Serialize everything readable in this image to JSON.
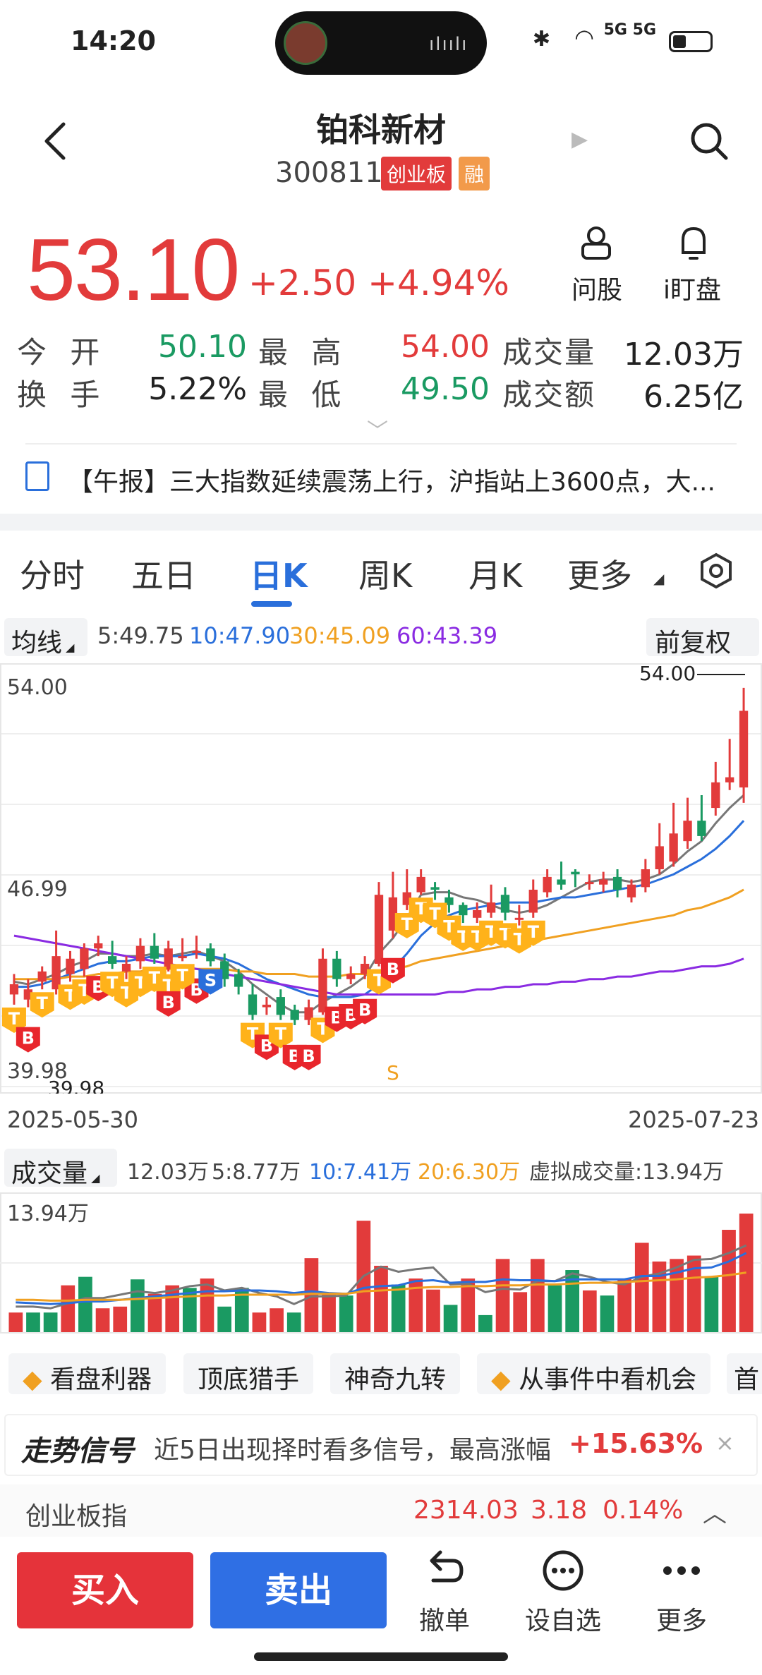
{
  "status_bar": {
    "time": "14:20",
    "signal": "5G 5G"
  },
  "header": {
    "stock_name": "铂科新材",
    "stock_code": "300811",
    "board_tag": "创业板",
    "margin_tag": "融"
  },
  "price": {
    "last": "53.10",
    "change": "+2.50",
    "change_pct": "+4.94%"
  },
  "actions": {
    "ask_label": "问股",
    "watch_label": "i盯盘"
  },
  "quote": {
    "open_label": "今 开",
    "open": "50.10",
    "high_label": "最 高",
    "high": "54.00",
    "volume_label": "成交量",
    "volume": "12.03万",
    "turnover_label": "换 手",
    "turnover": "5.22%",
    "low_label": "最 低",
    "low": "49.50",
    "amount_label": "成交额",
    "amount": "6.25亿"
  },
  "news": {
    "text": "【午报】三大指数延续震荡上行，沪指站上3600点，大..."
  },
  "tabs": [
    "分时",
    "五日",
    "日K",
    "周K",
    "月K",
    "更多"
  ],
  "active_tab": "日K",
  "ma": {
    "dropdown": "均线",
    "ma5": "5:49.75",
    "ma10": "10:47.90",
    "ma30": "30:45.09",
    "ma60": "60:43.39",
    "adjust": "前复权"
  },
  "chart_labels": {
    "y_top": "54.00",
    "y_mid": "46.99",
    "y_bottom": "39.98",
    "high_marker": "54.00",
    "low_marker": "39.98",
    "date_start": "2025-05-30",
    "date_end": "2025-07-23",
    "signal_s": "S"
  },
  "volume": {
    "dropdown": "成交量",
    "current": "12.03万",
    "ma5": "5:8.77万",
    "ma10": "10:7.41万",
    "ma20": "20:6.30万",
    "virtual": "虚拟成交量:13.94万",
    "y_top": "13.94万"
  },
  "chart_data": {
    "type": "candlestick",
    "dates": [
      "2025-05-30",
      "2025-07-23"
    ],
    "ylim": [
      39.98,
      54.0
    ],
    "open": [
      42.0,
      41.8,
      42.5,
      42.2,
      42.8,
      43.0,
      43.8,
      43.5,
      42.9,
      43.3,
      43.9,
      43.0,
      43.5,
      43.7,
      43.8,
      43.3,
      42.8,
      42.0,
      41.5,
      41.9,
      41.4,
      41.0,
      41.3,
      43.4,
      42.6,
      42.8,
      43.2,
      44.5,
      45.5,
      46.0,
      46.2,
      45.8,
      45.5,
      45.0,
      45.2,
      45.9,
      45.0,
      45.2,
      46.0,
      46.5,
      46.8,
      46.4,
      46.3,
      46.6,
      45.8,
      46.2,
      46.9,
      47.2,
      48.0,
      48.8,
      49.3,
      50.3,
      50.1
    ],
    "close": [
      42.4,
      42.2,
      42.9,
      43.5,
      43.4,
      43.8,
      44.0,
      43.2,
      43.2,
      43.9,
      43.4,
      43.8,
      43.5,
      43.7,
      43.3,
      42.6,
      42.3,
      41.2,
      41.6,
      41.2,
      41.0,
      41.5,
      43.4,
      42.6,
      42.8,
      43.2,
      45.9,
      45.8,
      46.0,
      46.6,
      46.1,
      45.5,
      45.1,
      45.3,
      45.6,
      45.2,
      45.0,
      46.1,
      46.6,
      46.3,
      46.7,
      46.4,
      46.5,
      46.1,
      46.3,
      46.9,
      47.8,
      48.3,
      48.8,
      48.2,
      50.3,
      50.5,
      53.1
    ],
    "high": [
      42.8,
      42.6,
      43.1,
      44.5,
      43.7,
      44.0,
      44.3,
      44.1,
      43.5,
      44.2,
      44.4,
      44.1,
      44.2,
      44.3,
      44.0,
      43.6,
      43.0,
      42.4,
      41.9,
      42.2,
      41.6,
      41.8,
      43.8,
      43.7,
      43.1,
      43.5,
      46.4,
      46.8,
      46.9,
      46.9,
      46.4,
      46.1,
      45.6,
      45.6,
      46.3,
      46.2,
      45.5,
      46.5,
      46.9,
      47.2,
      46.9,
      46.7,
      46.8,
      46.9,
      46.5,
      47.3,
      48.7,
      49.5,
      49.7,
      49.8,
      51.1,
      52.0,
      54.0
    ],
    "low": [
      41.6,
      41.5,
      42.2,
      42.0,
      42.5,
      42.7,
      43.5,
      43.0,
      42.6,
      43.0,
      43.2,
      42.9,
      43.3,
      43.4,
      43.1,
      42.3,
      42.0,
      41.0,
      41.2,
      41.0,
      40.8,
      40.8,
      41.2,
      42.3,
      42.4,
      42.6,
      43.1,
      44.2,
      45.3,
      45.9,
      45.7,
      45.2,
      44.8,
      44.8,
      45.0,
      44.9,
      44.7,
      45.0,
      45.8,
      46.1,
      46.2,
      46.1,
      46.0,
      45.8,
      45.6,
      46.0,
      46.7,
      47.0,
      47.7,
      48.0,
      49.0,
      50.0,
      49.5
    ],
    "ma_series": [
      {
        "name": "5",
        "color": "#777777",
        "values": [
          42.5,
          42.4,
          42.6,
          42.8,
          43.1,
          43.3,
          43.6,
          43.6,
          43.5,
          43.5,
          43.6,
          43.5,
          43.6,
          43.7,
          43.5,
          43.3,
          42.9,
          42.4,
          42.0,
          41.6,
          41.3,
          41.3,
          41.7,
          42.0,
          42.3,
          42.7,
          43.6,
          44.2,
          45.0,
          45.9,
          46.0,
          46.0,
          45.8,
          45.7,
          45.5,
          45.3,
          45.2,
          45.3,
          45.5,
          45.8,
          46.1,
          46.4,
          46.5,
          46.5,
          46.4,
          46.5,
          46.7,
          47.1,
          47.6,
          48.0,
          48.7,
          49.3,
          49.8
        ]
      },
      {
        "name": "10",
        "color": "#2a6fdb",
        "values": [
          42.3,
          42.3,
          42.4,
          42.6,
          42.8,
          43.0,
          43.2,
          43.3,
          43.3,
          43.4,
          43.5,
          43.5,
          43.5,
          43.6,
          43.5,
          43.4,
          43.2,
          42.9,
          42.6,
          42.4,
          42.2,
          42.0,
          41.9,
          41.9,
          41.9,
          42.0,
          42.4,
          43.0,
          43.6,
          44.3,
          44.8,
          45.1,
          45.3,
          45.4,
          45.5,
          45.6,
          45.6,
          45.6,
          45.7,
          45.8,
          45.8,
          45.9,
          46.0,
          46.1,
          46.2,
          46.3,
          46.5,
          46.7,
          47.0,
          47.3,
          47.7,
          48.2,
          48.8
        ]
      },
      {
        "name": "30",
        "color": "#f0a021",
        "values": [
          42.6,
          42.6,
          42.6,
          42.6,
          42.7,
          42.7,
          42.8,
          42.8,
          42.9,
          42.9,
          43.0,
          43.0,
          43.0,
          43.0,
          43.0,
          43.0,
          42.9,
          42.9,
          42.8,
          42.8,
          42.8,
          42.7,
          42.7,
          42.7,
          42.8,
          42.8,
          42.9,
          43.0,
          43.1,
          43.3,
          43.4,
          43.5,
          43.6,
          43.7,
          43.8,
          43.9,
          44.0,
          44.1,
          44.2,
          44.3,
          44.4,
          44.5,
          44.6,
          44.7,
          44.8,
          44.9,
          45.0,
          45.1,
          45.3,
          45.4,
          45.6,
          45.8,
          46.1
        ]
      },
      {
        "name": "60",
        "color": "#8a2be2",
        "values": [
          44.3,
          44.2,
          44.1,
          44.0,
          43.9,
          43.8,
          43.7,
          43.6,
          43.5,
          43.4,
          43.3,
          43.2,
          43.1,
          43.0,
          42.9,
          42.8,
          42.7,
          42.6,
          42.5,
          42.4,
          42.3,
          42.2,
          42.1,
          42.0,
          42.0,
          42.0,
          42.0,
          42.0,
          42.0,
          42.0,
          42.0,
          42.1,
          42.1,
          42.2,
          42.2,
          42.3,
          42.3,
          42.4,
          42.4,
          42.5,
          42.5,
          42.6,
          42.6,
          42.7,
          42.7,
          42.8,
          42.9,
          42.9,
          43.0,
          43.1,
          43.1,
          43.2,
          43.4
        ]
      }
    ],
    "signals": [
      {
        "i": 0,
        "t": "T"
      },
      {
        "i": 1,
        "t": "B"
      },
      {
        "i": 2,
        "t": "T"
      },
      {
        "i": 4,
        "t": "T"
      },
      {
        "i": 5,
        "t": "T"
      },
      {
        "i": 6,
        "t": "B"
      },
      {
        "i": 7,
        "t": "T"
      },
      {
        "i": 8,
        "t": "T"
      },
      {
        "i": 9,
        "t": "T"
      },
      {
        "i": 10,
        "t": "T"
      },
      {
        "i": 11,
        "t": "T"
      },
      {
        "i": 12,
        "t": "T"
      },
      {
        "i": 13,
        "t": "B"
      },
      {
        "i": 14,
        "t": "S"
      },
      {
        "i": 11,
        "t": "B"
      },
      {
        "i": 12,
        "t": "T"
      },
      {
        "i": 17,
        "t": "T"
      },
      {
        "i": 18,
        "t": "B"
      },
      {
        "i": 19,
        "t": "T"
      },
      {
        "i": 20,
        "t": "B"
      },
      {
        "i": 21,
        "t": "B"
      },
      {
        "i": 22,
        "t": "T"
      },
      {
        "i": 23,
        "t": "B"
      },
      {
        "i": 24,
        "t": "B"
      },
      {
        "i": 25,
        "t": "B"
      },
      {
        "i": 26,
        "t": "T"
      },
      {
        "i": 27,
        "t": "B"
      },
      {
        "i": 28,
        "t": "T"
      },
      {
        "i": 29,
        "t": "T"
      },
      {
        "i": 30,
        "t": "T"
      },
      {
        "i": 31,
        "t": "T"
      },
      {
        "i": 32,
        "t": "T"
      },
      {
        "i": 33,
        "t": "T"
      },
      {
        "i": 34,
        "t": "T"
      },
      {
        "i": 35,
        "t": "T"
      },
      {
        "i": 36,
        "t": "T"
      },
      {
        "i": 37,
        "t": "T"
      }
    ],
    "volume_values": [
      2.3,
      2.3,
      2.3,
      5.5,
      6.5,
      2.8,
      3.0,
      6.2,
      4.5,
      5.5,
      5.2,
      6.3,
      3.0,
      5.2,
      2.3,
      2.8,
      2.3,
      8.7,
      4.4,
      4.3,
      13.1,
      7.8,
      5.6,
      6.3,
      5.0,
      3.2,
      6.3,
      2.0,
      8.6,
      4.7,
      8.6,
      5.5,
      7.3,
      4.9,
      4.3,
      6.3,
      10.5,
      8.3,
      8.6,
      9.0,
      6.5,
      12.03,
      13.94
    ],
    "volume_ma": [
      {
        "name": "5",
        "color": "#777777",
        "values": [
          3.0,
          3.0,
          2.8,
          3.4,
          4.0,
          4.0,
          4.4,
          4.8,
          4.6,
          4.9,
          5.4,
          5.6,
          4.9,
          5.2,
          4.6,
          4.2,
          3.3,
          4.2,
          4.2,
          4.3,
          6.6,
          7.7,
          7.1,
          7.4,
          7.6,
          5.6,
          5.7,
          4.7,
          5.1,
          5.0,
          6.0,
          6.0,
          6.9,
          6.5,
          5.9,
          5.6,
          6.5,
          6.9,
          7.6,
          8.5,
          8.6,
          9.3,
          10.2
        ]
      },
      {
        "name": "10",
        "color": "#2a6fdb",
        "values": [
          3.5,
          3.4,
          3.3,
          3.4,
          3.6,
          3.6,
          3.8,
          4.0,
          4.2,
          4.4,
          4.6,
          4.8,
          4.8,
          4.9,
          4.9,
          4.8,
          4.6,
          4.8,
          4.6,
          4.5,
          5.2,
          5.4,
          5.5,
          6.0,
          6.1,
          5.8,
          5.9,
          5.9,
          6.2,
          6.1,
          6.1,
          6.0,
          6.2,
          6.2,
          6.2,
          6.2,
          6.6,
          6.6,
          7.0,
          7.5,
          7.6,
          8.3,
          9.3
        ]
      },
      {
        "name": "20",
        "color": "#f0a021",
        "values": [
          3.8,
          3.8,
          3.7,
          3.7,
          3.8,
          3.8,
          3.8,
          3.9,
          4.0,
          4.1,
          4.2,
          4.3,
          4.3,
          4.4,
          4.4,
          4.4,
          4.4,
          4.5,
          4.5,
          4.5,
          4.8,
          4.9,
          5.0,
          5.2,
          5.3,
          5.3,
          5.4,
          5.4,
          5.5,
          5.5,
          5.6,
          5.6,
          5.7,
          5.8,
          5.8,
          5.9,
          6.0,
          6.1,
          6.2,
          6.4,
          6.5,
          6.7,
          7.0
        ]
      }
    ],
    "volume_ylim": [
      0,
      13.94
    ]
  },
  "tools": [
    "看盘利器",
    "顶底猎手",
    "神奇九转",
    "从事件中看机会",
    "首"
  ],
  "signal": {
    "title": "走势信号",
    "text": "近5日出现择时看多信号，最高涨幅",
    "pct": "+15.63%",
    "close": "×"
  },
  "index": {
    "name": "创业板指",
    "value": "2314.03",
    "change": "3.18",
    "pct": "0.14%"
  },
  "bottom": {
    "buy": "买入",
    "sell": "卖出",
    "cancel": "撤单",
    "favorite": "设自选",
    "more": "更多"
  }
}
